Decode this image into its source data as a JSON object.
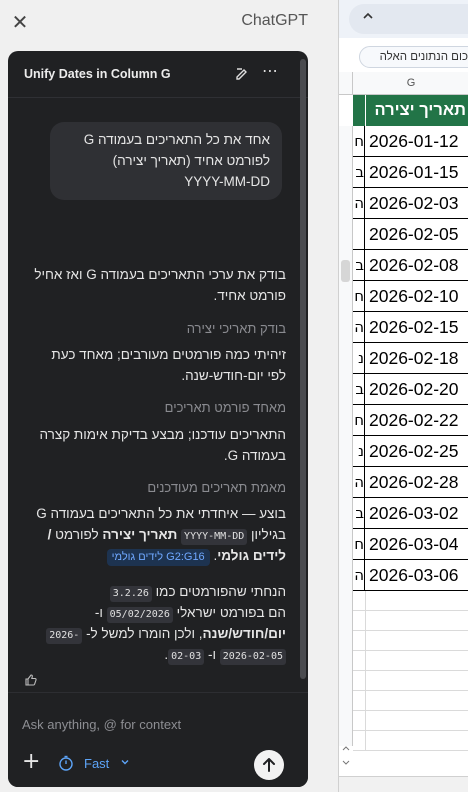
{
  "side_panel": {
    "app_title": "ChatGPT",
    "thread_title": "Unify Dates in Column G"
  },
  "conversation": {
    "user_message": {
      "line1": "אחד את כל התאריכים בעמודה G",
      "line2": "לפורמט אחיד (תאריך יצירה)",
      "line3": "YYYY-MM-DD"
    },
    "intro": {
      "line1": "בודק את ערכי התאריכים בעמודה G ואז אחיל",
      "line2": "פורמט אחיד."
    },
    "steps": [
      {
        "heading": "בודק תאריכי יצירה",
        "line1": "זיהיתי כמה פורמטים מעורבים; מאחד כעת",
        "line2": "לפי יום-חודש-שנה."
      },
      {
        "heading": "מאחד פורמט תאריכים",
        "line1": "התאריכים עודכנו; מבצע בדיקת אימות קצרה",
        "line2": "בעמודה G."
      },
      {
        "heading": "מאמת תאריכים מעודכנים"
      }
    ],
    "result": {
      "line1": "בוצע — איחדתי את כל התאריכים בעמודה G",
      "line2_pre": "בגיליון",
      "sheet_name": "לידים גולמי",
      "line2_mid": "לפורמט",
      "column_name": "תאריך יצירה",
      "format_code": "YYYY-MM-DD",
      "range_badge": "G2:G16 לידים גולמי",
      "slash": "/"
    },
    "note": {
      "line1_pre": "הנחתי שהפורמטים כמו",
      "example_1": "3.2.26",
      "line2_pre": "הם בפורמט ישראלי",
      "example_2": "05/02/2026",
      "line2_conj": "ו-",
      "bold_phrase": "יום/חודש/שנה",
      "line3_post": ", ולכן הומרו למשל ל-",
      "result_a": "2026-",
      "result_b": "2026-02-05",
      "line4_conj": "ו-",
      "result_c": "02-03",
      "period": "."
    }
  },
  "composer": {
    "placeholder": "Ask anything, @ for context",
    "speed_label": "Fast"
  },
  "sheet": {
    "filter_hint": "כום הנתונים האלה",
    "column_letter": "G",
    "header": "תאריך יצירה",
    "dates": [
      "2026-01-12",
      "2026-01-15",
      "2026-02-03",
      "2026-02-05",
      "2026-02-08",
      "2026-02-10",
      "2026-02-15",
      "2026-02-18",
      "2026-02-20",
      "2026-02-22",
      "2026-02-25",
      "2026-02-28",
      "2026-03-02",
      "2026-03-04",
      "2026-03-06"
    ],
    "left_col_fragments": [
      "ח",
      "ב",
      "ה",
      "",
      "ב",
      "ח",
      "ה",
      "נ",
      "ב",
      "ח",
      "נ",
      "ה",
      "ב",
      "ח",
      "ה"
    ]
  },
  "colors": {
    "panel_bg": "#202123",
    "header_green": "#227447",
    "accent_blue": "#5da4f7"
  }
}
